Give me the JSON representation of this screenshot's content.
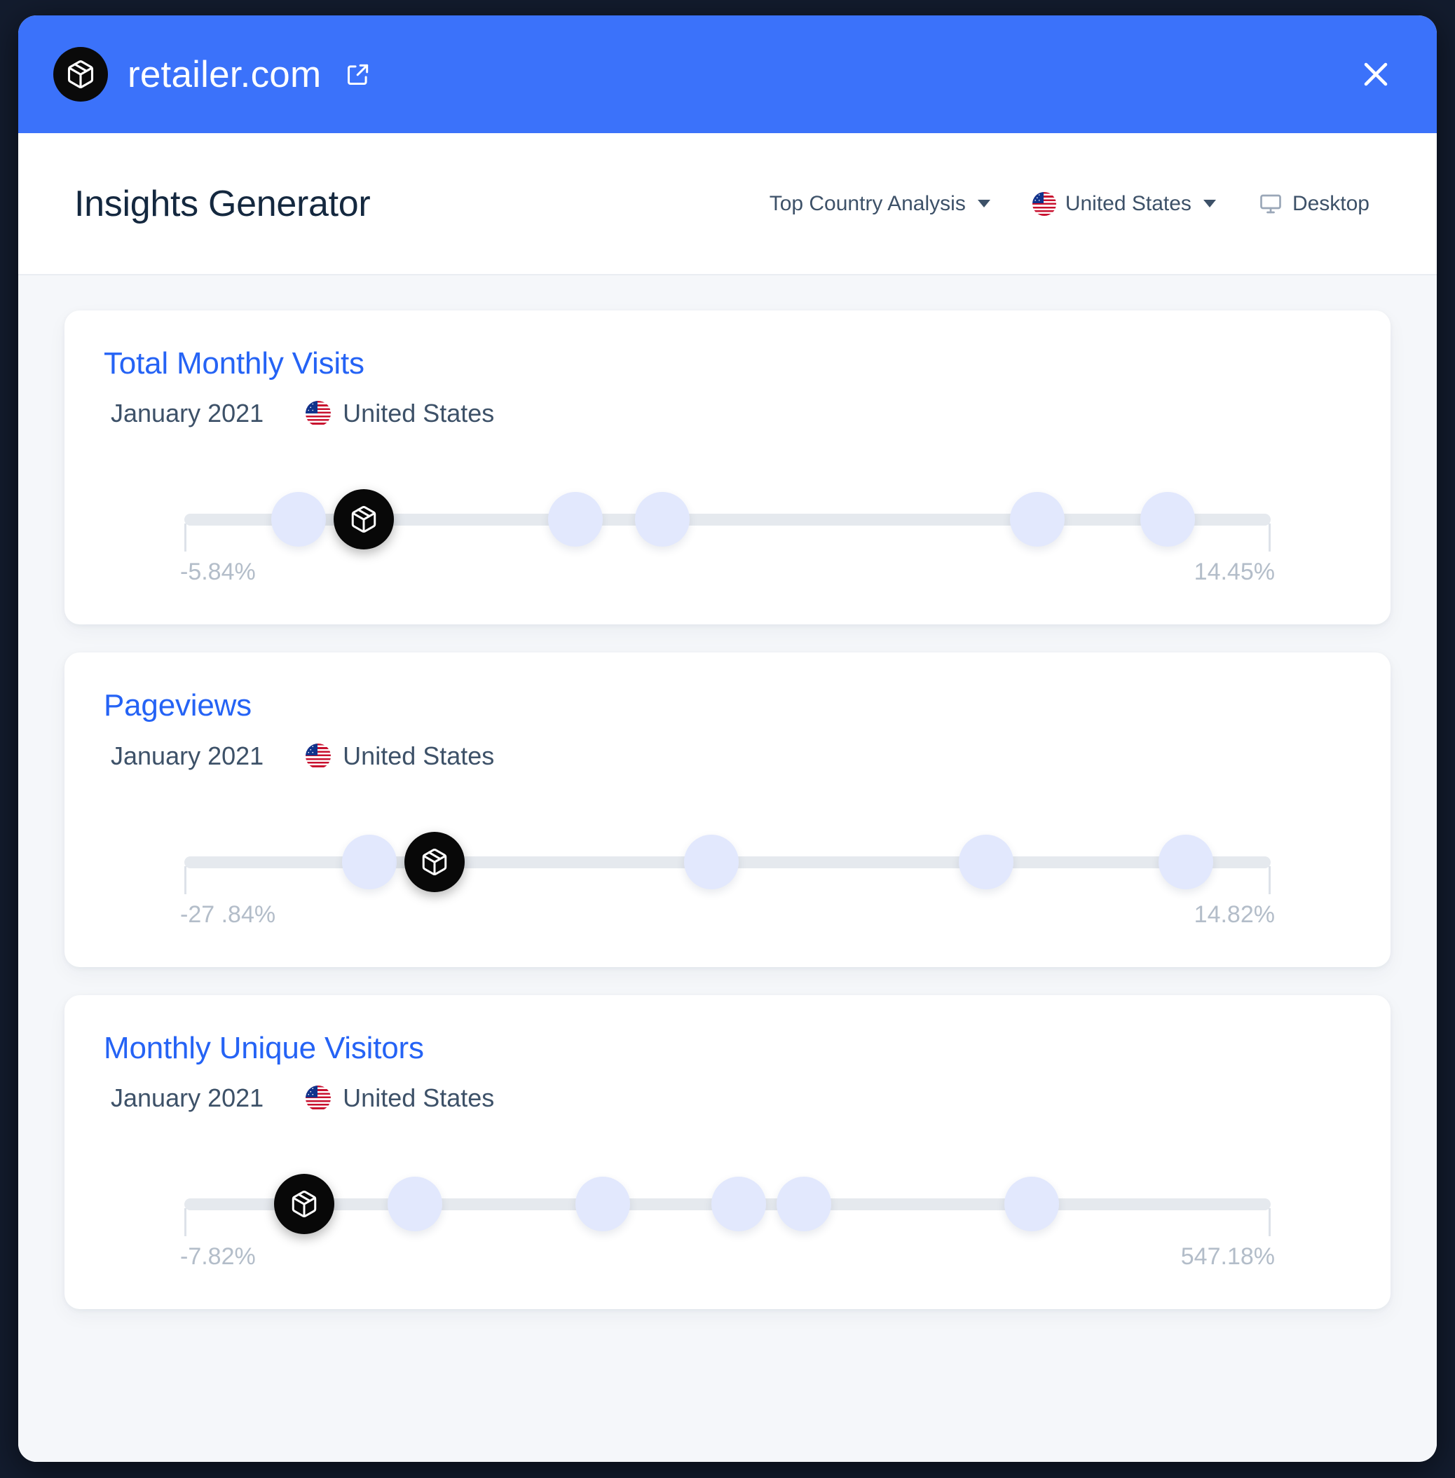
{
  "titlebar": {
    "domain": "retailer.com",
    "brand_icon": "cube-box-icon",
    "external_link_icon": "external-link-icon",
    "close_icon": "close-icon",
    "bg_color": "#3b72fa"
  },
  "header": {
    "title": "Insights Generator",
    "controls": [
      {
        "label": "Top Country Analysis",
        "icon": "chevron-down-icon",
        "has_flag": false,
        "has_monitor": false
      },
      {
        "label": "United States",
        "icon": "chevron-down-icon",
        "has_flag": true,
        "has_monitor": false
      },
      {
        "label": "Desktop",
        "icon": "",
        "has_flag": false,
        "has_monitor": true
      }
    ]
  },
  "theme": {
    "accent": "#2563f5",
    "title_bar": "#3b72fa",
    "page_bg": "#f5f7fa",
    "card_bg": "#ffffff",
    "dot": "#e2e8fd",
    "dot_active": "#080808",
    "track": "#e5e9ee",
    "range_label": "#b3bdc9",
    "meta_text": "#3d5168"
  },
  "cards": [
    {
      "title": "Total Monthly Visits",
      "date": "January 2021",
      "country": "United States",
      "range_min": "-5.84%",
      "range_max": "14.45%",
      "active_icon": "cube-box-icon",
      "dots": [
        {
          "position": 10.5,
          "active": false
        },
        {
          "position": 16.5,
          "active": true
        },
        {
          "position": 36.0,
          "active": false
        },
        {
          "position": 44.0,
          "active": false
        },
        {
          "position": 78.5,
          "active": false
        },
        {
          "position": 90.5,
          "active": false
        }
      ]
    },
    {
      "title": "Pageviews",
      "date": "January 2021",
      "country": "United States",
      "range_min": "-27 .84%",
      "range_max": "14.82%",
      "active_icon": "cube-box-icon",
      "dots": [
        {
          "position": 17.0,
          "active": false
        },
        {
          "position": 23.0,
          "active": true
        },
        {
          "position": 48.5,
          "active": false
        },
        {
          "position": 73.8,
          "active": false
        },
        {
          "position": 92.2,
          "active": false
        }
      ]
    },
    {
      "title": "Monthly Unique Visitors",
      "date": "January 2021",
      "country": "United States",
      "range_min": "-7.82%",
      "range_max": "547.18%",
      "active_icon": "cube-box-icon",
      "dots": [
        {
          "position": 11.0,
          "active": true
        },
        {
          "position": 21.2,
          "active": false
        },
        {
          "position": 38.5,
          "active": false
        },
        {
          "position": 51.0,
          "active": false
        },
        {
          "position": 57.0,
          "active": false
        },
        {
          "position": 78.0,
          "active": false
        }
      ]
    }
  ]
}
